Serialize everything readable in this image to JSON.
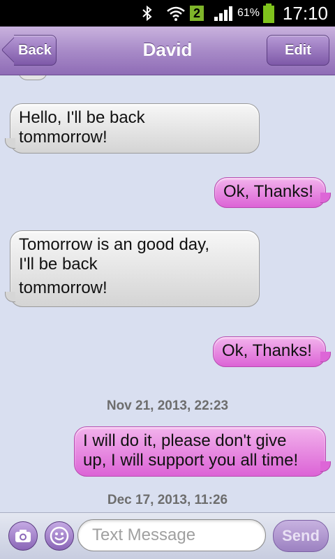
{
  "status_bar": {
    "icons": [
      "bluetooth-icon",
      "wifi-icon",
      "sim-icon",
      "signal-icon",
      "battery-icon"
    ],
    "sim_badge": "2",
    "battery_percent": "61%",
    "time": "17:10"
  },
  "header": {
    "back_label": "Back",
    "title": "David",
    "edit_label": "Edit"
  },
  "messages": [
    {
      "direction": "incoming",
      "lines": [
        "Hello, I'll be back",
        "tommorrow!"
      ]
    },
    {
      "direction": "outgoing",
      "lines": [
        "Ok, Thanks!"
      ]
    },
    {
      "direction": "incoming",
      "lines": [
        "Tomorrow is an good day,",
        "I'll be back",
        "tommorrow!"
      ]
    },
    {
      "direction": "outgoing",
      "lines": [
        "Ok, Thanks!"
      ]
    },
    {
      "type": "timestamp",
      "text": "Nov 21, 2013, 22:23"
    },
    {
      "direction": "outgoing",
      "lines": [
        "I will do it, please don't give",
        "up, I will support you all time!"
      ]
    },
    {
      "type": "timestamp",
      "text": "Dec 17, 2013, 11:26"
    }
  ],
  "composer": {
    "placeholder": "Text Message",
    "send_label": "Send",
    "icons": [
      "camera-icon",
      "emoticon-icon"
    ]
  },
  "colors": {
    "header_purple": "#a88bc8",
    "outgoing_bubble": "#dc63d6",
    "incoming_bubble": "#d4d4d4",
    "background": "#d9dff0"
  }
}
